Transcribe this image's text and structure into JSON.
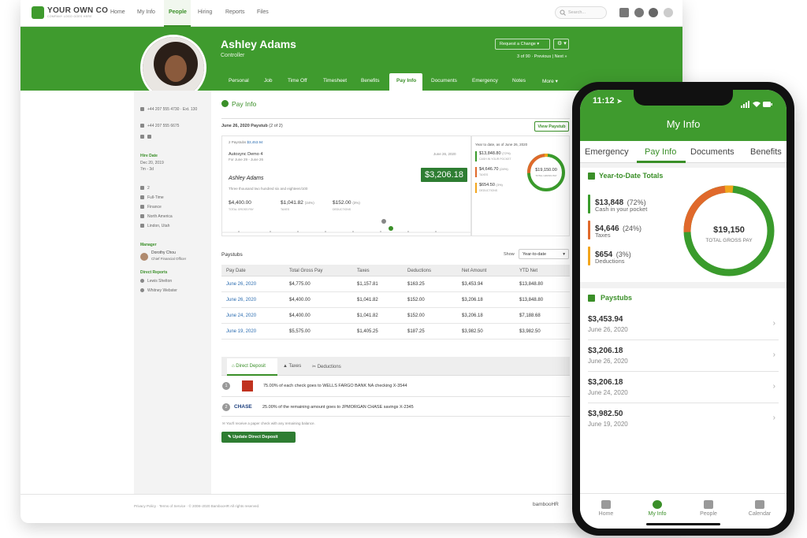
{
  "desktop": {
    "logo": {
      "name": "YOUR OWN CO",
      "tagline": "COMPANY LOGO GOES HERE"
    },
    "nav": [
      "Home",
      "My Info",
      "People",
      "Hiring",
      "Reports",
      "Files"
    ],
    "search_placeholder": "Search...",
    "employee": {
      "name": "Ashley Adams",
      "title": "Controller"
    },
    "request_change": "Request a Change",
    "pager": "3 of 90 · Previous | Next »",
    "tabs": [
      "Personal",
      "Job",
      "Time Off",
      "Timesheet",
      "Benefits",
      "Pay Info",
      "Documents",
      "Emergency",
      "Notes",
      "More"
    ],
    "sidebar": {
      "phone_work": "+44 207 555 4730 · Ext. 130",
      "phone_mobile": "+44 207 555 6675",
      "hire_date_label": "Hire Date",
      "hire_date": "Dec 20, 2019",
      "hire_tenure": "7m - 3d",
      "emp_no": "2",
      "status": "Full-Time",
      "department": "Finance",
      "division": "North America",
      "location": "Lindon, Utah",
      "manager_label": "Manager",
      "manager_name": "Dorothy Chou",
      "manager_title": "Chief Financial Officer",
      "reports_label": "Direct Reports",
      "reports": [
        "Lewis Shelton",
        "Whitney Webster"
      ]
    },
    "section_title": "Pay Info",
    "paystub_title": "June 26, 2020 Paystub",
    "paystub_count": "(2 of 2)",
    "view_paystub": "View Paystub",
    "paystub_card": {
      "paystubs_label": "2 Paystubs",
      "paystubs_amount": "$3,453.94",
      "company": "Autosync Demo 4",
      "period": "For June 29 - June 26",
      "date": "June 26, 2020",
      "employee": "Ashley Adams",
      "amount_words": "Three thousand two hundred six and eighteen/100",
      "net": "$3,206.18",
      "gross": "$4,400.00",
      "gross_label": "TOTAL GROSS PAY",
      "taxes": "$1,041.82",
      "taxes_pct": "(24%)",
      "taxes_label": "TAXES",
      "deductions": "$152.00",
      "deductions_pct": "(3%)",
      "deductions_label": "DEDUCTIONS"
    },
    "ytd_card": {
      "title": "Year to date, as of June 26, 2020",
      "cash": "$13,848.80",
      "cash_pct": "(72%)",
      "cash_label": "CASH IN YOUR POCKET",
      "taxes": "$4,646.70",
      "taxes_pct": "(24%)",
      "taxes_label": "TAXES",
      "deductions": "$654.50",
      "deductions_pct": "(3%)",
      "deductions_label": "DEDUCTIONS",
      "center_amount": "$19,150.00",
      "center_label": "TOTAL GROSS PAY"
    },
    "paystubs_title": "Paystubs",
    "show_label": "Show",
    "show_value": "Year-to-date",
    "table": {
      "headers": [
        "Pay Date",
        "Total Gross Pay",
        "Taxes",
        "Deductions",
        "Net Amount",
        "YTD Net"
      ],
      "rows": [
        [
          "June 26, 2020",
          "$4,775.00",
          "$1,157.81",
          "$163.25",
          "$3,453.94",
          "$13,848.80"
        ],
        [
          "June 26, 2020",
          "$4,400.00",
          "$1,041.82",
          "$152.00",
          "$3,206.18",
          "$13,848.80"
        ],
        [
          "June 24, 2020",
          "$4,400.00",
          "$1,041.82",
          "$152.00",
          "$3,206.18",
          "$7,188.68"
        ],
        [
          "June 19, 2020",
          "$5,575.00",
          "$1,405.25",
          "$187.25",
          "$3,982.50",
          "$3,982.50"
        ]
      ]
    },
    "deposit_tabs": [
      "Direct Deposit",
      "Taxes",
      "Deductions"
    ],
    "deposits": [
      {
        "num": "1",
        "text": "75.00% of each check goes to WELLS FARGO BANK NA checking X-3544"
      },
      {
        "num": "2",
        "bank": "CHASE",
        "text": "25.00% of the remaining amount goes to JPMORGAN CHASE savings X-2345"
      }
    ],
    "paper_check": "You'll receive a paper check with any remaining balance.",
    "update_deposit": "Update Direct Deposit",
    "footer": "Privacy Policy · Terms of Service · © 2008–2020 BambooHR All rights reserved.",
    "footer_brand": "bambooHR"
  },
  "phone": {
    "time": "11:12",
    "title": "My Info",
    "tabs": [
      "Emergency",
      "Pay Info",
      "Documents",
      "Benefits"
    ],
    "ytd_title": "Year-to-Date Totals",
    "items": [
      {
        "amount": "$13,848",
        "pct": "(72%)",
        "label": "Cash in your pocket",
        "color": "#3a9b2c"
      },
      {
        "amount": "$4,646",
        "pct": "(24%)",
        "label": "Taxes",
        "color": "#e0692b"
      },
      {
        "amount": "$654",
        "pct": "(3%)",
        "label": "Deductions",
        "color": "#f2a51c"
      }
    ],
    "donut_amount": "$19,150",
    "donut_label": "TOTAL GROSS PAY",
    "donut_shares": [
      0.72,
      0.24,
      0.03
    ],
    "paystubs_title": "Paystubs",
    "paystubs": [
      {
        "amount": "$3,453.94",
        "date": "June 26, 2020"
      },
      {
        "amount": "$3,206.18",
        "date": "June 26, 2020"
      },
      {
        "amount": "$3,206.18",
        "date": "June 24, 2020"
      },
      {
        "amount": "$3,982.50",
        "date": "June 19, 2020"
      }
    ],
    "bottom_nav": [
      "Home",
      "My Info",
      "People",
      "Calendar"
    ]
  }
}
